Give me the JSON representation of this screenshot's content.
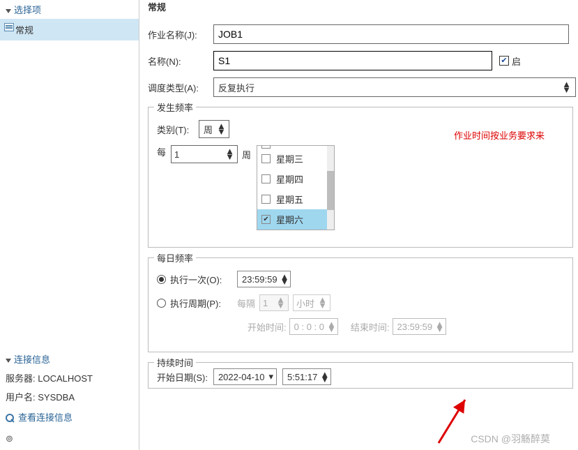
{
  "sidebar": {
    "options_title": "选择项",
    "item_general": "常规",
    "conn_info_title": "连接信息",
    "server_label": "服务器:",
    "server_value": "LOCALHOST",
    "user_label": "用户名:",
    "user_value": "SYSDBA",
    "view_conn": "查看连接信息"
  },
  "main": {
    "section_title": "常规",
    "job_label": "作业名称(J):",
    "job_value": "JOB1",
    "name_label": "名称(N):",
    "name_value": "S1",
    "enable_label": "启",
    "sched_type_label": "调度类型(A):",
    "sched_type_value": "反复执行"
  },
  "freq": {
    "legend": "发生频率",
    "note": "作业时间按业务要求来",
    "type_label": "类别(T):",
    "type_value": "周",
    "every_label": "每",
    "every_value": "1",
    "every_unit": "周",
    "options": [
      "星期三",
      "星期四",
      "星期五",
      "星期六"
    ],
    "selected_index": 3
  },
  "daily": {
    "legend": "每日频率",
    "once_label": "执行一次(O):",
    "once_time": "23:59:59",
    "period_label": "执行周期(P):",
    "period_every": "每隔",
    "period_val": "1",
    "period_unit": "小时",
    "start_label": "开始时间:",
    "start_val": "0 : 0 : 0",
    "end_label": "结束时间:",
    "end_val": "23:59:59"
  },
  "duration": {
    "legend": "持续时间",
    "start_date_label": "开始日期(S):",
    "start_date": "2022-04-10",
    "start_time": "5:51:17"
  },
  "watermark": "CSDN @羽觞醉莫"
}
